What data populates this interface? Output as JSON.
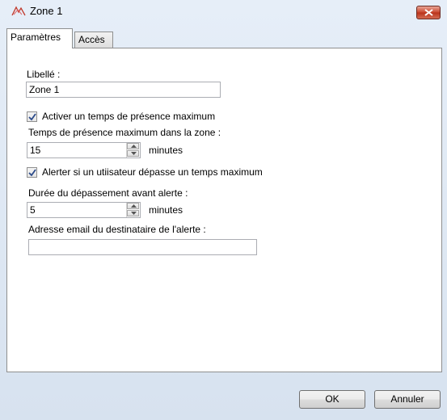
{
  "window": {
    "title": "Zone 1"
  },
  "tabs": [
    {
      "label": "Paramètres",
      "active": true
    },
    {
      "label": "Accès",
      "active": false
    }
  ],
  "form": {
    "libelle_label": "Libellé :",
    "libelle_value": "Zone 1",
    "max_presence_checkbox_label": "Activer un temps de présence maximum",
    "max_presence_checked": true,
    "max_presence_time_label": "Temps de présence maximum dans la zone :",
    "max_presence_time_value": "15",
    "max_presence_unit": "minutes",
    "alert_checkbox_label": "Alerter si un utiisateur dépasse un temps maximum",
    "alert_checked": true,
    "alert_delay_label": "Durée du dépassement avant alerte :",
    "alert_delay_value": "5",
    "alert_delay_unit": "minutes",
    "email_label": "Adresse email du destinataire de l'alerte :",
    "email_value": ""
  },
  "buttons": {
    "ok": "OK",
    "cancel": "Annuler"
  },
  "icons": {
    "title": "zone-icon",
    "close": "close-icon",
    "check": "check-icon",
    "spin_up": "arrow-up-icon",
    "spin_down": "arrow-down-icon"
  },
  "colors": {
    "close_button": "#c9462d",
    "window_frame": "#dde7f3"
  }
}
